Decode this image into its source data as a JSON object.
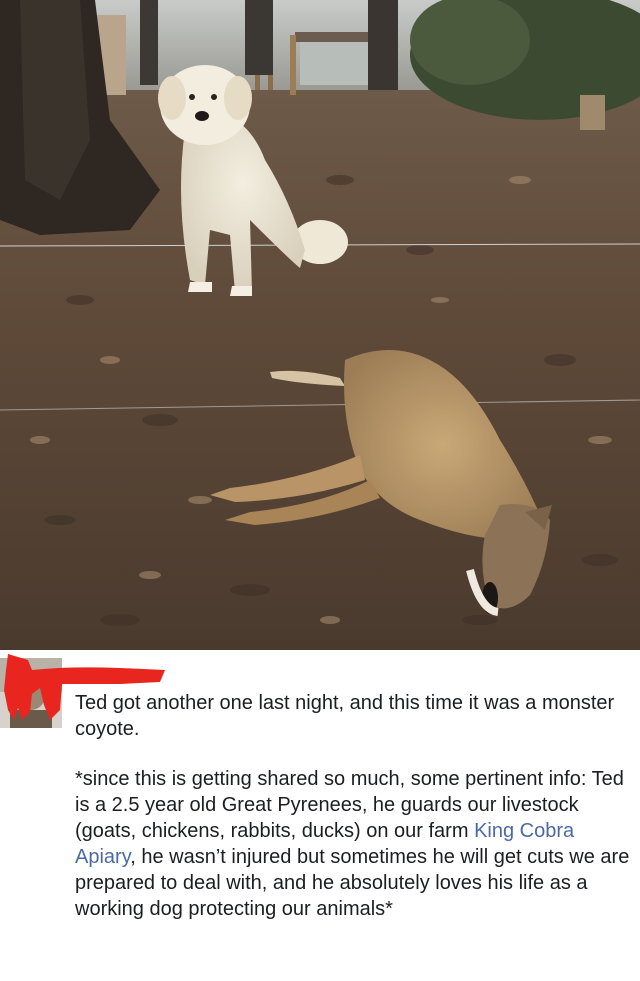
{
  "photo": {
    "subject_dog": "Ted",
    "subject_animal": "coyote"
  },
  "post": {
    "author_name_redacted": true,
    "line1": "Ted got another one last night, and this time it was a monster coyote.",
    "p2_before_link": "*since this is getting shared so much, some pertinent info: Ted is a 2.5 year old Great Pyrenees, he guards our livestock (goats, chickens, rabbits, ducks) on our farm ",
    "p2_link": "King Cobra Apiary",
    "p2_after_link": ", he wasn’t injured but sometimes he will get cuts we are prepared to deal with, and he absolutely loves his life as a working dog protecting our animals*"
  },
  "colors": {
    "link": "#4b6aa5",
    "redaction": "#e8261f",
    "text": "#1c1e21"
  }
}
